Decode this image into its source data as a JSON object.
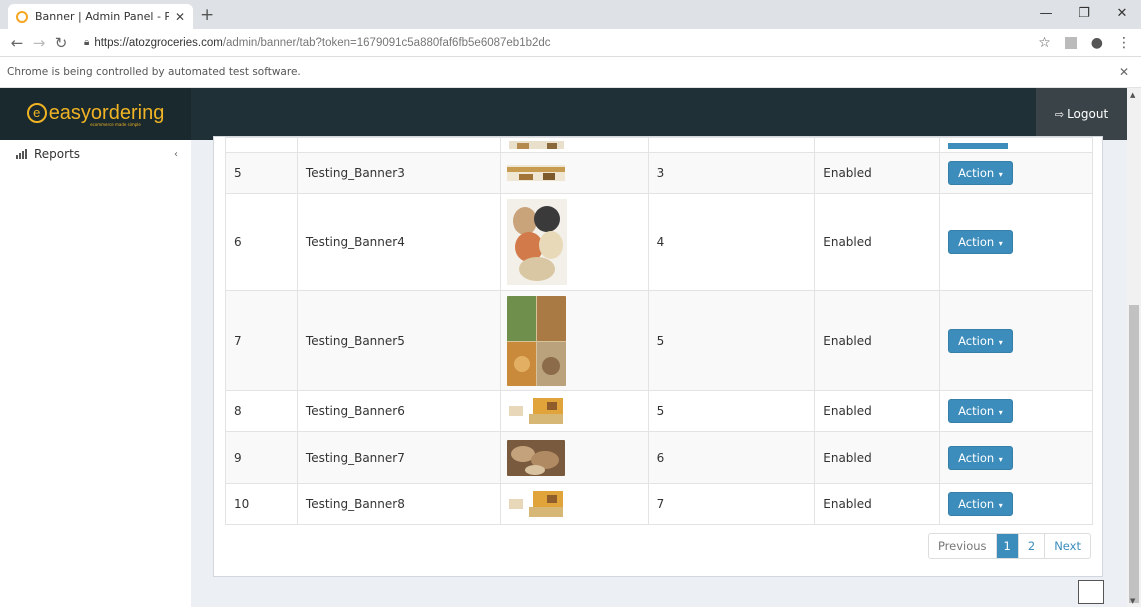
{
  "browser": {
    "tab_title": "Banner | Admin Panel - Powered",
    "url_host": "https://atozgroceries.com",
    "url_path": "/admin/banner/tab?token=1679091c5a880faf6fb5e6087eb1b2dc",
    "automation_notice": "Chrome is being controlled by automated test software."
  },
  "header": {
    "logo_text": "easyordering",
    "logo_tagline": "ecommerce made simple",
    "logout_label": "Logout"
  },
  "sidebar": {
    "items": [
      {
        "label": "Reports"
      }
    ]
  },
  "table": {
    "rows": [
      {
        "id": "5",
        "name": "Testing_Banner3",
        "position": "3",
        "status": "Enabled",
        "action": "Action"
      },
      {
        "id": "6",
        "name": "Testing_Banner4",
        "position": "4",
        "status": "Enabled",
        "action": "Action"
      },
      {
        "id": "7",
        "name": "Testing_Banner5",
        "position": "5",
        "status": "Enabled",
        "action": "Action"
      },
      {
        "id": "8",
        "name": "Testing_Banner6",
        "position": "5",
        "status": "Enabled",
        "action": "Action"
      },
      {
        "id": "9",
        "name": "Testing_Banner7",
        "position": "6",
        "status": "Enabled",
        "action": "Action"
      },
      {
        "id": "10",
        "name": "Testing_Banner8",
        "position": "7",
        "status": "Enabled",
        "action": "Action"
      }
    ]
  },
  "pagination": {
    "previous": "Previous",
    "pages": [
      "1",
      "2"
    ],
    "next": "Next",
    "active_page": "1"
  },
  "colors": {
    "header_bg": "#1f3036",
    "logo": "#f0b323",
    "action_button": "#3c8dbc"
  }
}
